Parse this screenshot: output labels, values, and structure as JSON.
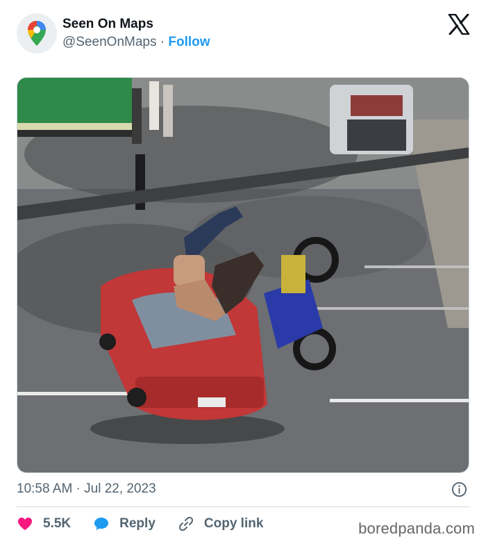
{
  "author": {
    "name": "Seen On Maps",
    "handle": "@SeenOnMaps",
    "separator": "·",
    "follow_label": "Follow"
  },
  "post": {
    "timestamp": "10:58 AM · Jul 22, 2023"
  },
  "actions": {
    "like_count": "5.5K",
    "reply_label": "Reply",
    "copy_link_label": "Copy link"
  },
  "watermark": "boredpanda.com",
  "colors": {
    "accent": "#1d9bf0",
    "like": "#f91880",
    "secondary_text": "#536471",
    "divider": "#cfd9de"
  },
  "icons": {
    "avatar": "google-maps-pin-icon",
    "brand": "x-logo-icon",
    "info": "info-icon",
    "like": "heart-icon",
    "reply": "speech-bubble-icon",
    "copy": "link-icon"
  }
}
